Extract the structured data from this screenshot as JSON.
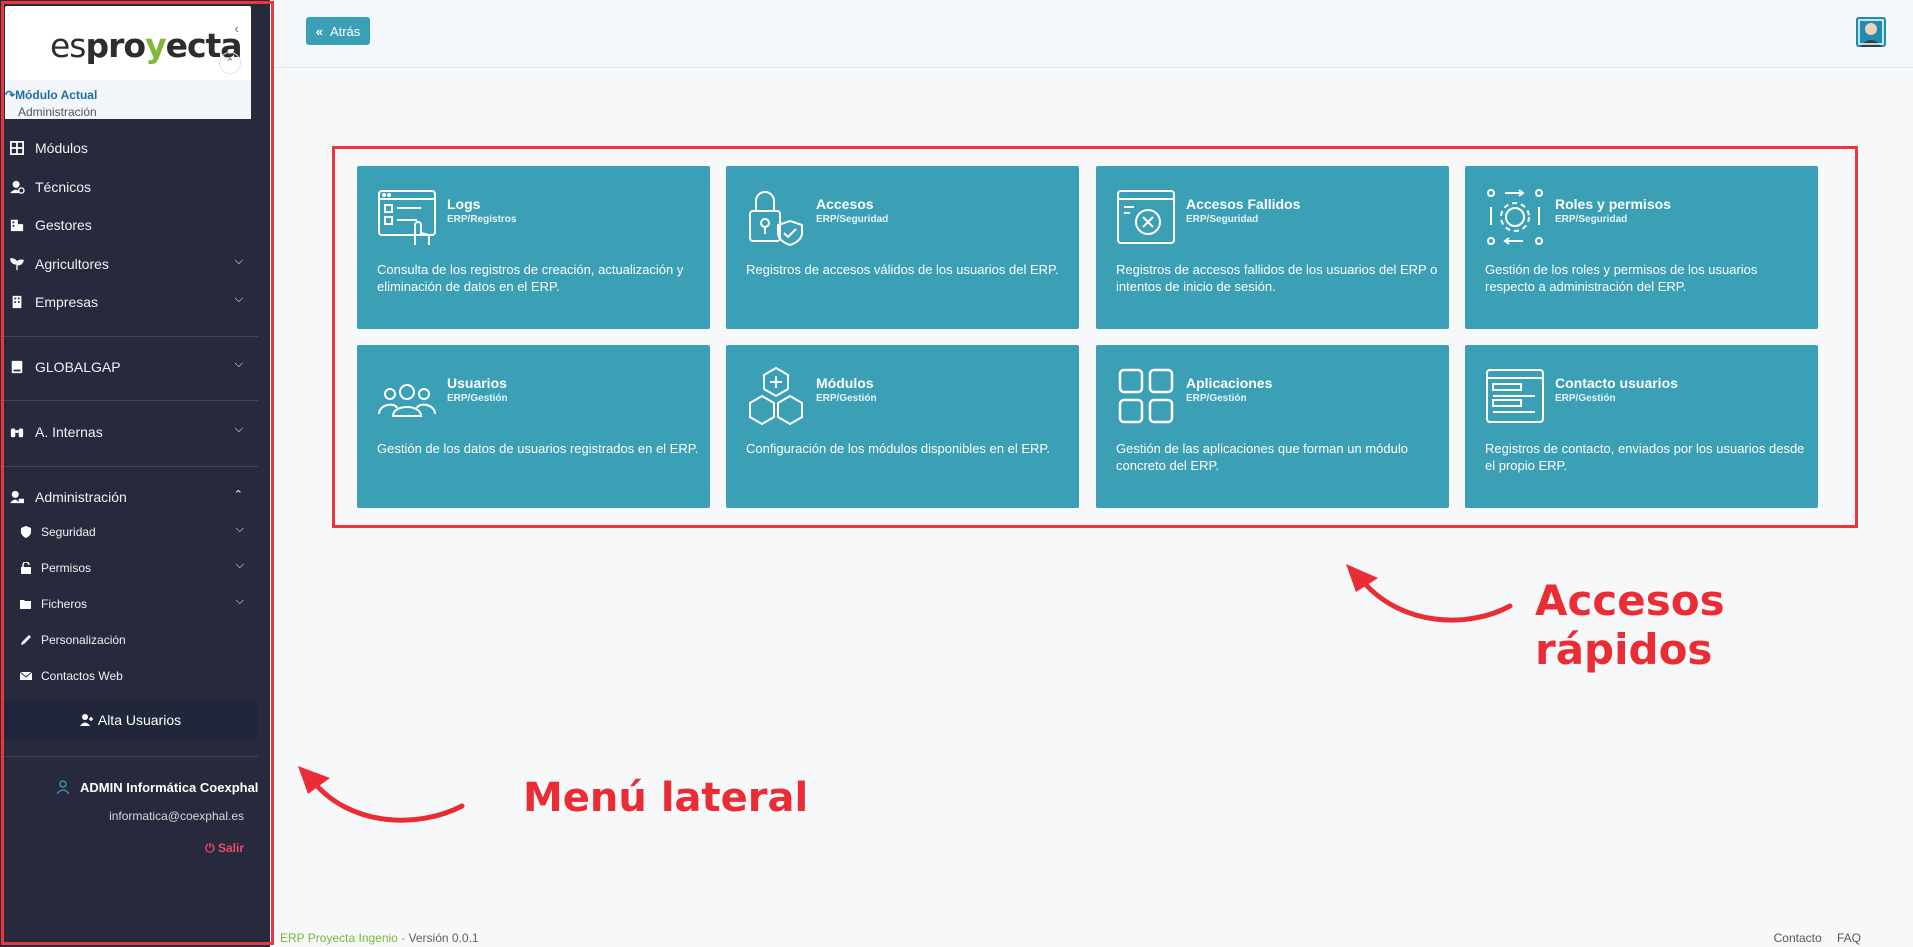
{
  "sidebar": {
    "logo": {
      "part1": "es",
      "part2": "pro",
      "part3": "y",
      "part4": "ecta"
    },
    "current_module_label": "Módulo Actual",
    "current_module_value": "Administración",
    "menu": [
      {
        "label": "Módulos",
        "has_chevron": false
      },
      {
        "label": "Técnicos",
        "has_chevron": false
      },
      {
        "label": "Gestores",
        "has_chevron": false
      },
      {
        "label": "Agricultores",
        "has_chevron": true
      },
      {
        "label": "Empresas",
        "has_chevron": true
      },
      {
        "label": "GLOBALGAP",
        "has_chevron": true
      },
      {
        "label": "A. Internas",
        "has_chevron": true
      },
      {
        "label": "Administración",
        "has_chevron": true
      }
    ],
    "submenu": [
      {
        "label": "Seguridad"
      },
      {
        "label": "Permisos"
      },
      {
        "label": "Ficheros"
      },
      {
        "label": "Personalización"
      },
      {
        "label": "Contactos Web"
      }
    ],
    "alta_label": "Alta Usuarios",
    "user_name": "ADMIN Informática Coexphal",
    "user_email": "informatica@coexphal.es",
    "logout_label": "Salir"
  },
  "topbar": {
    "back_label": "Atrás"
  },
  "cards": [
    {
      "title": "Logs",
      "path": "ERP/Registros",
      "desc": "Consulta de los registros de creación, actualización y eliminación de datos en el ERP.",
      "icon": "logs-icon"
    },
    {
      "title": "Accesos",
      "path": "ERP/Seguridad",
      "desc": "Registros de accesos válidos de los usuarios del ERP.",
      "icon": "lock-shield-icon"
    },
    {
      "title": "Accesos Fallidos",
      "path": "ERP/Seguridad",
      "desc": "Registros de accesos fallidos de los usuarios del ERP o intentos de inicio de sesión.",
      "icon": "failed-access-icon"
    },
    {
      "title": "Roles y permisos",
      "path": "ERP/Seguridad",
      "desc": "Gestión de los roles y permisos de los usuarios respecto a administración del ERP.",
      "icon": "roles-icon"
    },
    {
      "title": "Usuarios",
      "path": "ERP/Gestión",
      "desc": "Gestión de los datos de usuarios registrados en el ERP.",
      "icon": "users-icon"
    },
    {
      "title": "Módulos",
      "path": "ERP/Gestión",
      "desc": "Configuración de los módulos disponibles en el ERP.",
      "icon": "modules-icon"
    },
    {
      "title": "Aplicaciones",
      "path": "ERP/Gestión",
      "desc": "Gestión de las aplicaciones que forman un módulo concreto del ERP.",
      "icon": "apps-icon"
    },
    {
      "title": "Contacto usuarios",
      "path": "ERP/Gestión",
      "desc": "Registros de contacto, enviados por los usuarios desde el propio ERP.",
      "icon": "contact-icon"
    }
  ],
  "annotations": {
    "menu": "Menú lateral",
    "quick": "Accesos rápidos"
  },
  "footer": {
    "left_app": "ERP Proyecta Ingenio",
    "left_sep": " - ",
    "left_version": "Versión 0.0.1",
    "right": "Contacto    FAQ"
  },
  "colors": {
    "sidebar": "#262a3c",
    "card": "#3b9fb6",
    "accent": "#e8373d",
    "logo_green": "#80b83a"
  }
}
